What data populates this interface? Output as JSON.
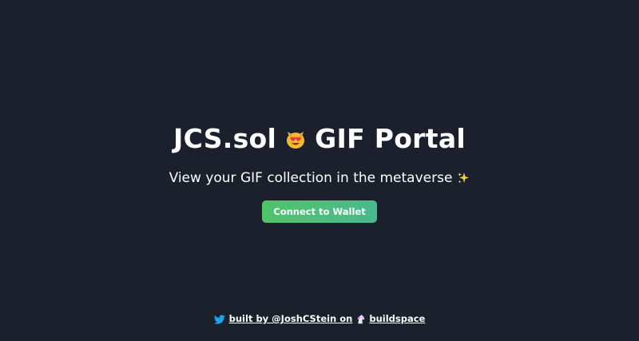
{
  "header": {
    "title_left": "JCS.sol",
    "title_emoji": "heart-eyes-cat-icon",
    "title_right": "GIF Portal",
    "subtitle": "View your GIF collection in the metaverse",
    "subtitle_emoji": "sparkles-icon"
  },
  "actions": {
    "connect_label": "Connect to Wallet"
  },
  "footer": {
    "icon": "twitter-icon",
    "link_prefix": "built by @JoshCStein on",
    "link_icon": "unicorn-icon",
    "link_suffix": "buildspace"
  },
  "colors": {
    "background": "#1a202c",
    "button_start": "#51c36a",
    "button_end": "#4ab98f",
    "twitter_blue": "#1da1f2"
  }
}
